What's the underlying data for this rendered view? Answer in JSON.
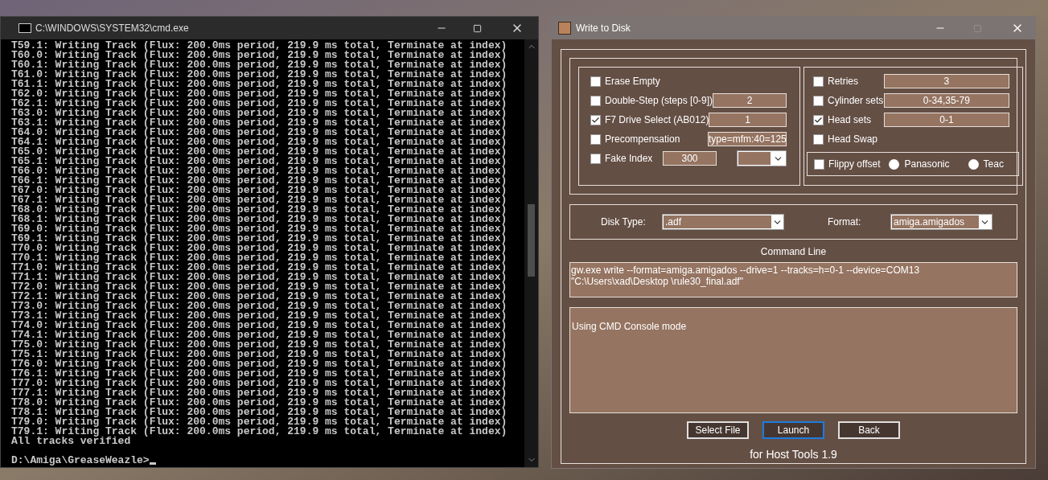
{
  "console": {
    "title": "C:\\WINDOWS\\SYSTEM32\\cmd.exe",
    "lines": [
      "T59.1: Writing Track (Flux: 200.0ms period, 219.9 ms total, Terminate at index)",
      "T60.0: Writing Track (Flux: 200.0ms period, 219.9 ms total, Terminate at index)",
      "T60.1: Writing Track (Flux: 200.0ms period, 219.9 ms total, Terminate at index)",
      "T61.0: Writing Track (Flux: 200.0ms period, 219.9 ms total, Terminate at index)",
      "T61.1: Writing Track (Flux: 200.0ms period, 219.9 ms total, Terminate at index)",
      "T62.0: Writing Track (Flux: 200.0ms period, 219.9 ms total, Terminate at index)",
      "T62.1: Writing Track (Flux: 200.0ms period, 219.9 ms total, Terminate at index)",
      "T63.0: Writing Track (Flux: 200.0ms period, 219.9 ms total, Terminate at index)",
      "T63.1: Writing Track (Flux: 200.0ms period, 219.9 ms total, Terminate at index)",
      "T64.0: Writing Track (Flux: 200.0ms period, 219.9 ms total, Terminate at index)",
      "T64.1: Writing Track (Flux: 200.0ms period, 219.9 ms total, Terminate at index)",
      "T65.0: Writing Track (Flux: 200.0ms period, 219.9 ms total, Terminate at index)",
      "T65.1: Writing Track (Flux: 200.0ms period, 219.9 ms total, Terminate at index)",
      "T66.0: Writing Track (Flux: 200.0ms period, 219.9 ms total, Terminate at index)",
      "T66.1: Writing Track (Flux: 200.0ms period, 219.9 ms total, Terminate at index)",
      "T67.0: Writing Track (Flux: 200.0ms period, 219.9 ms total, Terminate at index)",
      "T67.1: Writing Track (Flux: 200.0ms period, 219.9 ms total, Terminate at index)",
      "T68.0: Writing Track (Flux: 200.0ms period, 219.9 ms total, Terminate at index)",
      "T68.1: Writing Track (Flux: 200.0ms period, 219.9 ms total, Terminate at index)",
      "T69.0: Writing Track (Flux: 200.0ms period, 219.9 ms total, Terminate at index)",
      "T69.1: Writing Track (Flux: 200.0ms period, 219.9 ms total, Terminate at index)",
      "T70.0: Writing Track (Flux: 200.0ms period, 219.9 ms total, Terminate at index)",
      "T70.1: Writing Track (Flux: 200.0ms period, 219.9 ms total, Terminate at index)",
      "T71.0: Writing Track (Flux: 200.0ms period, 219.9 ms total, Terminate at index)",
      "T71.1: Writing Track (Flux: 200.0ms period, 219.9 ms total, Terminate at index)",
      "T72.0: Writing Track (Flux: 200.0ms period, 219.9 ms total, Terminate at index)",
      "T72.1: Writing Track (Flux: 200.0ms period, 219.9 ms total, Terminate at index)",
      "T73.0: Writing Track (Flux: 200.0ms period, 219.9 ms total, Terminate at index)",
      "T73.1: Writing Track (Flux: 200.0ms period, 219.9 ms total, Terminate at index)",
      "T74.0: Writing Track (Flux: 200.0ms period, 219.9 ms total, Terminate at index)",
      "T74.1: Writing Track (Flux: 200.0ms period, 219.9 ms total, Terminate at index)",
      "T75.0: Writing Track (Flux: 200.0ms period, 219.9 ms total, Terminate at index)",
      "T75.1: Writing Track (Flux: 200.0ms period, 219.9 ms total, Terminate at index)",
      "T76.0: Writing Track (Flux: 200.0ms period, 219.9 ms total, Terminate at index)",
      "T76.1: Writing Track (Flux: 200.0ms period, 219.9 ms total, Terminate at index)",
      "T77.0: Writing Track (Flux: 200.0ms period, 219.9 ms total, Terminate at index)",
      "T77.1: Writing Track (Flux: 200.0ms period, 219.9 ms total, Terminate at index)",
      "T78.0: Writing Track (Flux: 200.0ms period, 219.9 ms total, Terminate at index)",
      "T78.1: Writing Track (Flux: 200.0ms period, 219.9 ms total, Terminate at index)",
      "T79.0: Writing Track (Flux: 200.0ms period, 219.9 ms total, Terminate at index)",
      "T79.1: Writing Track (Flux: 200.0ms period, 219.9 ms total, Terminate at index)",
      "All tracks verified"
    ],
    "prompt": "D:\\Amiga\\GreaseWeazle>"
  },
  "dialog": {
    "title": "Write to Disk",
    "left_options": [
      {
        "kind": "check",
        "label": "Erase Empty",
        "checked": false
      },
      {
        "kind": "field",
        "label": "Double-Step (steps [0-9])",
        "checked": false,
        "value": "2"
      },
      {
        "kind": "field",
        "label": "F7 Drive Select (AB012)",
        "checked": true,
        "value": "1"
      },
      {
        "kind": "field",
        "label": "Precompensation",
        "checked": false,
        "value": "type=mfm:40=125"
      },
      {
        "kind": "index",
        "label": "Fake Index",
        "checked": false,
        "value": "300"
      }
    ],
    "right_options": [
      {
        "kind": "field",
        "label": "Retries",
        "checked": false,
        "value": "3"
      },
      {
        "kind": "field",
        "label": "Cylinder sets",
        "checked": false,
        "value": "0-34,35-79"
      },
      {
        "kind": "field",
        "label": "Head sets",
        "checked": true,
        "value": "0-1"
      },
      {
        "kind": "check",
        "label": "Head Swap",
        "checked": false
      }
    ],
    "flippy": {
      "label": "Flippy offset",
      "checked": false,
      "radios": [
        {
          "label": "Panasonic",
          "selected": false
        },
        {
          "label": "Teac",
          "selected": false
        }
      ]
    },
    "disk_type": {
      "label": "Disk Type:",
      "value": ".adf"
    },
    "format": {
      "label": "Format:",
      "value": "amiga.amigados"
    },
    "command_line": {
      "label": "Command Line",
      "text": "gw.exe write --format=amiga.amigados --drive=1 --tracks=h=0-1 --device=COM13 \"C:\\Users\\xad\\Desktop \\rule30_final.adf\""
    },
    "log": "Using CMD Console mode",
    "buttons": [
      {
        "label": "Select File",
        "focused": false
      },
      {
        "label": "Launch",
        "focused": true
      },
      {
        "label": "Back",
        "focused": false
      }
    ],
    "footer": "for Host Tools 1.9"
  }
}
